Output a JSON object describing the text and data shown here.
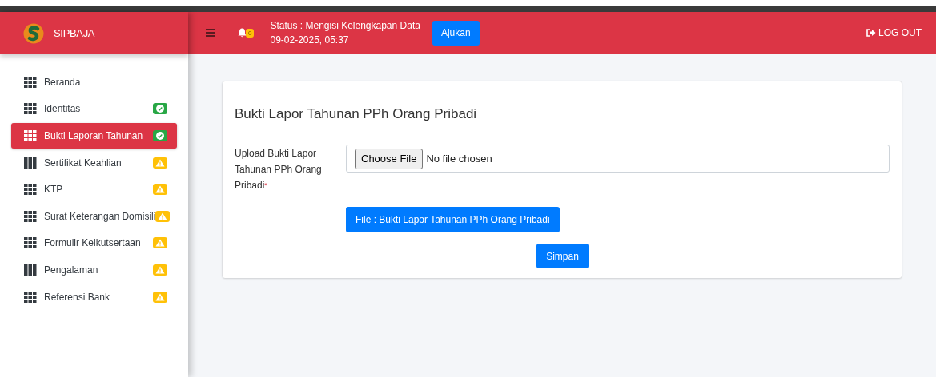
{
  "brand": {
    "name": "SIPBAJA"
  },
  "header": {
    "notification_count": "0",
    "status": "Status : Mengisi Kelengkapan Data",
    "timestamp": "09-02-2025, 05:37",
    "submit_button": "Ajukan",
    "logout": "LOG OUT"
  },
  "sidebar": {
    "items": [
      {
        "label": "Beranda",
        "selected": false
      },
      {
        "label": "Identitas",
        "selected": false,
        "kind": "complete"
      },
      {
        "label": "Bukti Laporan Tahunan",
        "selected": true,
        "kind": "complete"
      },
      {
        "label": "Sertifikat Keahlian",
        "selected": false,
        "kind": "warning"
      },
      {
        "label": "KTP",
        "selected": false,
        "kind": "warning"
      },
      {
        "label": "Surat Keterangan Domisili",
        "selected": false,
        "kind": "warning"
      },
      {
        "label": "Formulir Keikutsertaan",
        "selected": false,
        "kind": "warning"
      },
      {
        "label": "Pengalaman",
        "selected": false,
        "kind": "warning"
      },
      {
        "label": "Referensi Bank",
        "selected": false,
        "kind": "warning"
      }
    ]
  },
  "card": {
    "title": "Bukti Lapor Tahunan PPh Orang Pribadi",
    "field": {
      "label": "Upload Bukti Lapor Tahunan PPh Orang Pribadi",
      "required": true,
      "required_mark": "*",
      "choose_button": "Choose File",
      "value": "No file chosen"
    },
    "file_button": "File : Bukti Lapor Tahunan PPh Orang Pribadi",
    "save_button": "Simpan"
  }
}
